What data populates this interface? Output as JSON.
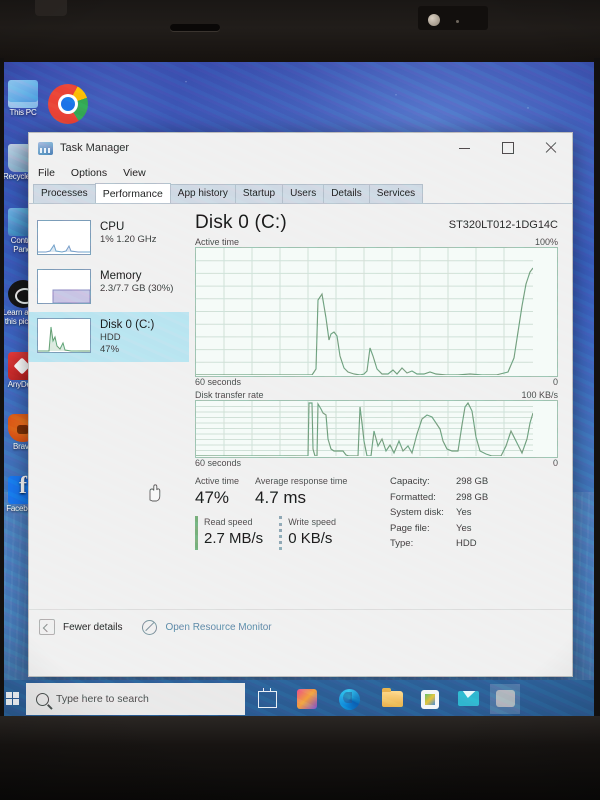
{
  "window": {
    "title": "Task Manager",
    "icon": "task-manager-icon",
    "controls": {
      "minimize": "–",
      "maximize": "□",
      "close": "✕"
    }
  },
  "menubar": {
    "items": [
      "File",
      "Options",
      "View"
    ]
  },
  "tabs": [
    {
      "label": "Processes",
      "selected": false
    },
    {
      "label": "Performance",
      "selected": true
    },
    {
      "label": "App history",
      "selected": false
    },
    {
      "label": "Startup",
      "selected": false
    },
    {
      "label": "Users",
      "selected": false
    },
    {
      "label": "Details",
      "selected": false
    },
    {
      "label": "Services",
      "selected": false
    }
  ],
  "sidebar": {
    "items": [
      {
        "name": "CPU",
        "sub1": "1%  1.20 GHz",
        "sub2": "",
        "selected": false
      },
      {
        "name": "Memory",
        "sub1": "2.3/7.7 GB (30%)",
        "sub2": "",
        "selected": false
      },
      {
        "name": "Disk 0 (C:)",
        "sub1": "HDD",
        "sub2": "47%",
        "selected": true
      }
    ]
  },
  "main": {
    "title": "Disk 0 (C:)",
    "model": "ST320LT012-1DG14C",
    "active_graph": {
      "label": "Active time",
      "max_label": "100%",
      "time_label": "60 seconds",
      "min_label": "0"
    },
    "transfer_graph": {
      "label": "Disk transfer rate",
      "max_label": "100 KB/s",
      "time_label": "60 seconds",
      "min_label": "0"
    },
    "stats": {
      "active_time_label": "Active time",
      "active_time_value": "47%",
      "avg_response_label": "Average response time",
      "avg_response_value": "4.7 ms",
      "read_speed_label": "Read speed",
      "read_speed_value": "2.7 MB/s",
      "write_speed_label": "Write speed",
      "write_speed_value": "0 KB/s",
      "details": [
        {
          "key": "Capacity:",
          "value": "298 GB"
        },
        {
          "key": "Formatted:",
          "value": "298 GB"
        },
        {
          "key": "System disk:",
          "value": "Yes"
        },
        {
          "key": "Page file:",
          "value": "Yes"
        },
        {
          "key": "Type:",
          "value": "HDD"
        }
      ]
    }
  },
  "footer": {
    "fewer_details": "Fewer details",
    "open_resource_monitor": "Open Resource Monitor"
  },
  "taskbar": {
    "search_placeholder": "Type here to search",
    "items": [
      {
        "name": "task-view",
        "label": ""
      },
      {
        "name": "office",
        "label": ""
      },
      {
        "name": "microsoft-edge",
        "label": ""
      },
      {
        "name": "file-explorer",
        "label": ""
      },
      {
        "name": "microsoft-store",
        "label": ""
      },
      {
        "name": "mail",
        "label": ""
      },
      {
        "name": "pinned-app",
        "label": ""
      }
    ]
  },
  "desktop": {
    "icons": [
      {
        "name": "this-pc",
        "label": "This PC"
      },
      {
        "name": "recycle-bin",
        "label": "Recycle Bin"
      },
      {
        "name": "control-panel",
        "label": "Control Panel"
      },
      {
        "name": "learn-about-this-picture",
        "label": "Learn about this picture"
      },
      {
        "name": "anydesk",
        "label": "AnyDesk"
      },
      {
        "name": "brave",
        "label": "Brave"
      },
      {
        "name": "facebook",
        "label": "Facebook"
      }
    ],
    "chrome_shortcut": "google-chrome-shortcut"
  },
  "colors": {
    "graph_line": "#6f9e7c",
    "graph_fill": "#d9ece0",
    "selection": "#b9e4f0",
    "link": "#5d8aa8",
    "taskbar": "#2a5a90"
  }
}
